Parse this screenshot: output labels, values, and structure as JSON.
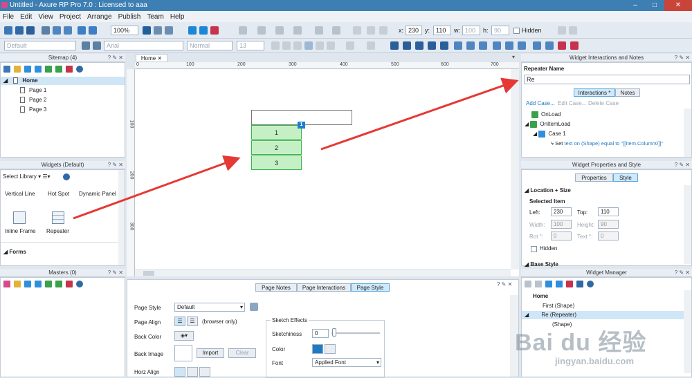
{
  "window": {
    "title": "Untitled - Axure RP Pro 7.0 : Licensed to aaa",
    "min": "–",
    "max": "□",
    "close": "✕"
  },
  "menu": [
    "File",
    "Edit",
    "View",
    "Project",
    "Arrange",
    "Publish",
    "Team",
    "Help"
  ],
  "toolbar": {
    "zoom": "100%",
    "x_label": "x:",
    "x_value": "230",
    "y_label": "y:",
    "y_value": "110",
    "w_label": "w:",
    "w_value": "100",
    "h_label": "h:",
    "h_value": "90",
    "hidden_label": "Hidden",
    "style_value": "Default",
    "font_value": "Arial",
    "weight_value": "Normal",
    "size_value": "13"
  },
  "sitemap": {
    "title": "Sitemap (4)",
    "home": "Home",
    "pages": [
      "Page 1",
      "Page 2",
      "Page 3"
    ]
  },
  "widgets": {
    "title": "Widgets (Default)",
    "select_library": "Select Library",
    "items": [
      "Vertical Line",
      "Hot Spot",
      "Dynamic Panel",
      "Inline Frame",
      "Repeater"
    ],
    "forms_label": "Forms"
  },
  "masters": {
    "title": "Masters (0)"
  },
  "canvas": {
    "tab": "Home",
    "ruler_h": [
      "0",
      "100",
      "200",
      "300",
      "400",
      "500",
      "600",
      "700"
    ],
    "ruler_v": [
      "100",
      "200",
      "300"
    ],
    "repeater_rows": [
      "1",
      "2",
      "3"
    ],
    "badge": "1"
  },
  "bottom_panel": {
    "tabs": [
      "Page Notes",
      "Page Interactions",
      "Page Style"
    ],
    "page_style_label": "Page Style",
    "page_style_value": "Default",
    "page_align_label": "Page Align",
    "browser_only": "(browser only)",
    "back_color_label": "Back Color",
    "back_image_label": "Back Image",
    "import_btn": "Import",
    "clear_btn": "Clear",
    "horz_align_label": "Horz Align",
    "sketch_effects": "Sketch Effects",
    "sketchiness_label": "Sketchiness",
    "sketchiness_value": "0",
    "color_label": "Color",
    "font_label": "Font",
    "font_value": "Applied Font"
  },
  "interactions_panel": {
    "title": "Widget Interactions and Notes",
    "repeater_name_label": "Repeater Name",
    "repeater_name_value": "Re",
    "tabs": [
      "Interactions *",
      "Notes"
    ],
    "add_case": "Add Case...",
    "edit_case": "Edit Case...",
    "delete_case": "Delete Case",
    "events": [
      "OnLoad",
      "OnItemLoad"
    ],
    "case": "Case 1",
    "action_prefix": "Set",
    "action_text": "text on (Shape) equal to \"[[Item.Column0]]\""
  },
  "properties_panel": {
    "title": "Widget Properties and Style",
    "tabs": [
      "Properties",
      "Style"
    ],
    "location_size": "Location + Size",
    "selected_item": "Selected Item",
    "left_label": "Left:",
    "left_value": "230",
    "top_label": "Top:",
    "top_value": "110",
    "width_label": "Width:",
    "width_value": "100",
    "height_label": "Height:",
    "height_value": "90",
    "rot_label": "Rot °:",
    "rot_value": "0",
    "text_label": "Text °:",
    "text_value": "0",
    "hidden_label": "Hidden",
    "base_style": "Base Style"
  },
  "widget_manager": {
    "title": "Widget Manager",
    "root": "Home",
    "items": [
      "First (Shape)",
      "Re (Repeater)",
      "(Shape)"
    ]
  },
  "watermark": {
    "text": "Bai du 经验",
    "sub": "jingyan.baidu.com"
  },
  "colors": {
    "accent": "#1f7ac4",
    "selection": "#cfe6f7",
    "repeater_fill": "#c5f0c5",
    "repeater_border": "#3bb24a",
    "arrow": "#e53935"
  }
}
